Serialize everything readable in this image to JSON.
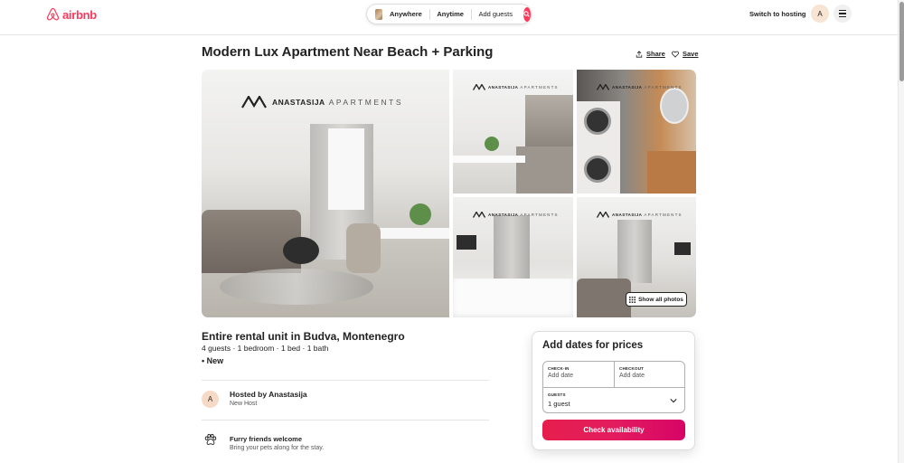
{
  "header": {
    "logo_text": "airbnb",
    "search": {
      "location": "Anywhere",
      "dates": "Anytime",
      "guests": "Add guests"
    },
    "switch_to_hosting": "Switch to hosting",
    "avatar_initial": "A"
  },
  "listing": {
    "title": "Modern Lux Apartment Near Beach + Parking",
    "share_label": "Share",
    "save_label": "Save",
    "brand_name": "ANASTASIJA",
    "brand_suffix": "APARTMENTS",
    "show_all_photos": "Show all photos",
    "subtitle": "Entire rental unit in Budva, Montenegro",
    "details": "4 guests · 1 bedroom · 1 bed · 1 bath",
    "badge": "• New",
    "host": {
      "avatar_initial": "A",
      "hosted_by": "Hosted by Anastasija",
      "status": "New Host"
    },
    "highlight": {
      "icon": "paw-icon",
      "title": "Furry friends welcome",
      "description": "Bring your pets along for the stay."
    }
  },
  "booking": {
    "title": "Add dates for prices",
    "checkin_label": "CHECK-IN",
    "checkin_value": "Add date",
    "checkout_label": "CHECKOUT",
    "checkout_value": "Add date",
    "guests_label": "GUESTS",
    "guests_value": "1 guest",
    "button_label": "Check availability"
  },
  "colors": {
    "brand": "#ff385c",
    "button_start": "#e61e4d",
    "button_end": "#d70466"
  }
}
